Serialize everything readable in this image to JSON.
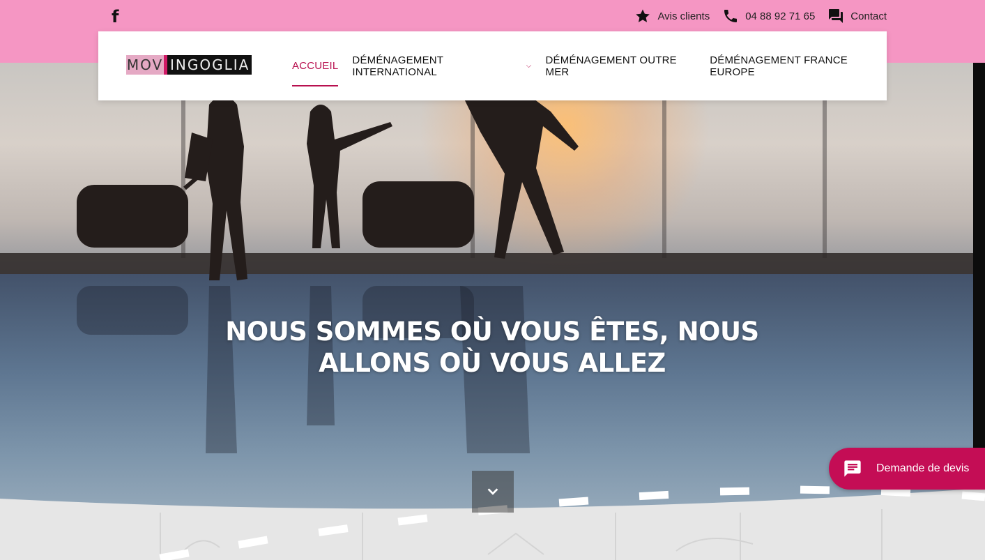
{
  "topbar": {
    "facebook_icon": "facebook-icon",
    "links": [
      {
        "label": "Avis clients",
        "icon": "star-icon"
      },
      {
        "label": "04 88 92 71 65",
        "icon": "phone-icon"
      },
      {
        "label": "Contact",
        "icon": "chat-icon"
      }
    ]
  },
  "logo": {
    "part1": "MOV",
    "part2": "INGOGLIA"
  },
  "nav": {
    "items": [
      {
        "label": "ACCUEIL",
        "active": true
      },
      {
        "label": "DÉMÉNAGEMENT INTERNATIONAL",
        "has_dropdown": true
      },
      {
        "label": "DÉMÉNAGEMENT OUTRE MER"
      },
      {
        "label": "DÉMÉNAGEMENT FRANCE EUROPE"
      }
    ]
  },
  "hero": {
    "title_line1": "NOUS SOMMES OÙ VOUS ÊTES, NOUS",
    "title_line2": "ALLONS OÙ VOUS ALLEZ"
  },
  "quote_button": {
    "label": "Demande de devis",
    "icon": "chat-bubble-icon"
  },
  "colors": {
    "accent": "#c40d55",
    "topbar": "#f596c3",
    "active_nav": "#b8104f"
  }
}
